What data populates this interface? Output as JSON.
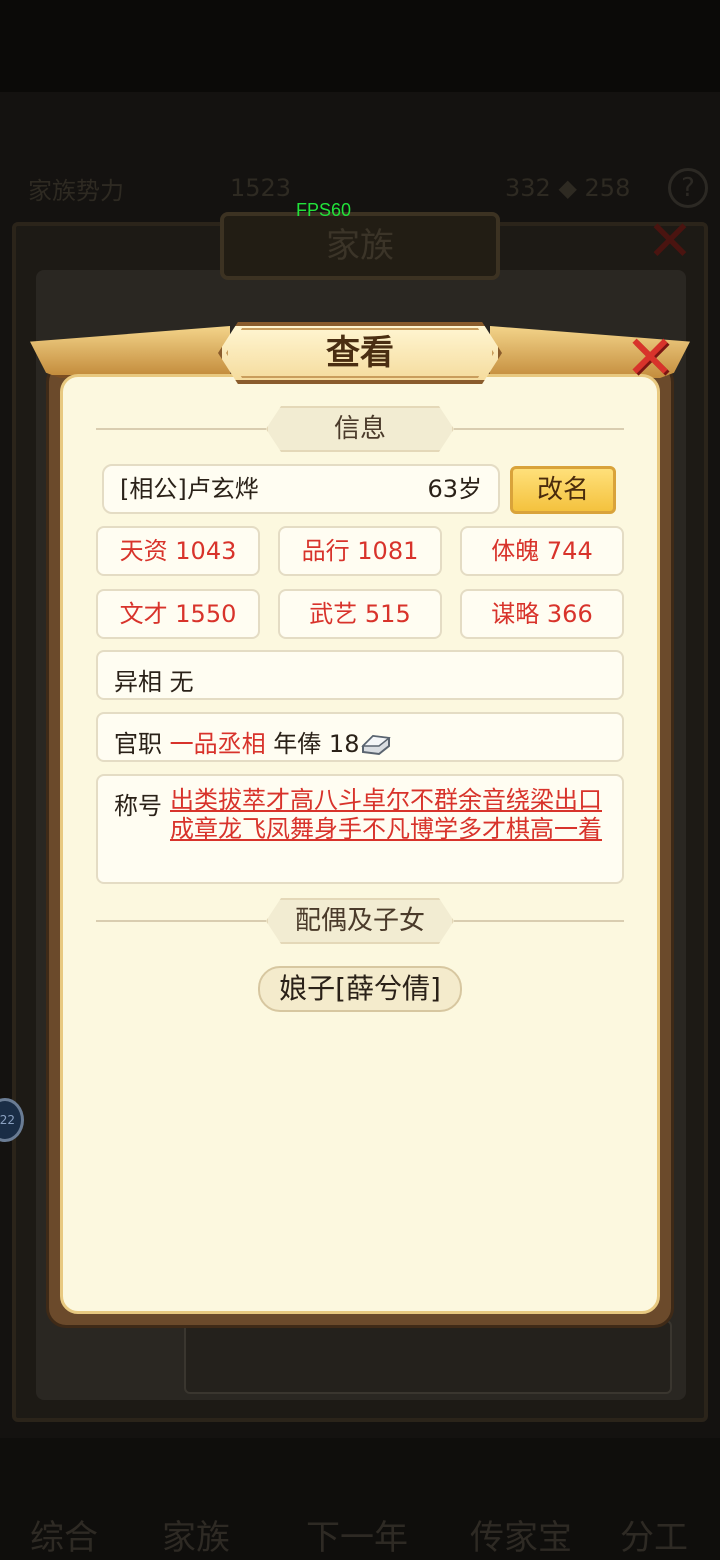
{
  "background": {
    "family_power_label": "家族势力",
    "family_power_value": "1523",
    "resource_a": "332",
    "resource_b": "258",
    "window_title": "家族",
    "nav": [
      "综合",
      "家族",
      "下一年",
      "传家宝",
      "分工"
    ],
    "badge": "22"
  },
  "fps": "FPS60",
  "dialog": {
    "title": "查看",
    "section_info": "信息",
    "name": "[相公]卢玄烨",
    "age": "63岁",
    "rename": "改名",
    "stats": [
      {
        "label": "天资",
        "value": "1043"
      },
      {
        "label": "品行",
        "value": "1081"
      },
      {
        "label": "体魄",
        "value": "744"
      },
      {
        "label": "文才",
        "value": "1550"
      },
      {
        "label": "武艺",
        "value": "515"
      },
      {
        "label": "谋略",
        "value": "366"
      }
    ],
    "trait_label": "异相",
    "trait_value": "无",
    "office_label": "官职",
    "office_value": "一品丞相",
    "salary_label": "年俸",
    "salary_value": "18",
    "titles_label": "称号",
    "titles_value": "出类拔萃才高八斗卓尔不群余音绕梁出口成章龙飞凤舞身手不凡博学多才棋高一着",
    "section_family": "配偶及子女",
    "spouse": "娘子[薛兮倩]"
  },
  "colors": {
    "stat_red": "#d8332b",
    "panel_cream": "#fcf8df",
    "gold": "#f4c23e"
  }
}
